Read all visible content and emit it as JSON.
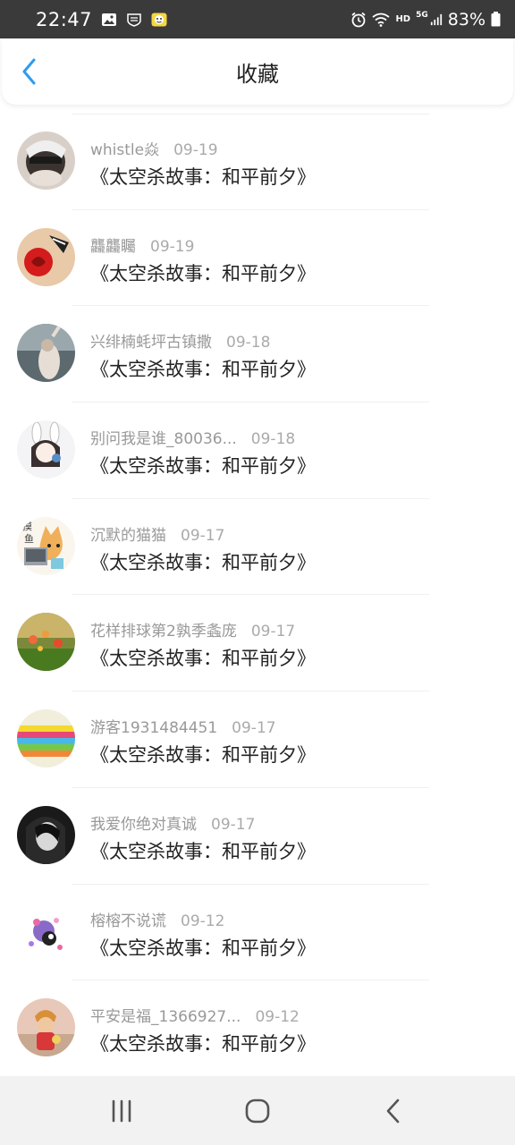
{
  "status_bar": {
    "time": "22:47",
    "icons_left": [
      "gallery-icon",
      "shield-icon",
      "app-face-icon"
    ],
    "icons_right": [
      "alarm-icon",
      "wifi-icon",
      "hd-icon",
      "5g-signal-icon",
      "battery-icon"
    ],
    "hd_label": "HD",
    "network_label": "5G",
    "battery": "83%"
  },
  "header": {
    "back_icon": "chevron-left-icon",
    "title": "收藏"
  },
  "colors": {
    "accent": "#2e9bf0",
    "status_bar": "#3a3a3a"
  },
  "favorites": [
    {
      "user": "whistle焱",
      "date": "09-19",
      "title": "《太空杀故事：和平前夕》"
    },
    {
      "user": "龘龘矚",
      "date": "09-19",
      "title": "《太空杀故事：和平前夕》"
    },
    {
      "user": "兴绯楠蚝坪古镇撒",
      "date": "09-18",
      "title": "《太空杀故事：和平前夕》"
    },
    {
      "user": "别问我是谁_80036...",
      "date": "09-18",
      "title": "《太空杀故事：和平前夕》"
    },
    {
      "user": "沉默的猫猫",
      "date": "09-17",
      "title": "《太空杀故事：和平前夕》"
    },
    {
      "user": "花样排球第2孰季螽庞",
      "date": "09-17",
      "title": "《太空杀故事：和平前夕》"
    },
    {
      "user": "游客1931484451",
      "date": "09-17",
      "title": "《太空杀故事：和平前夕》"
    },
    {
      "user": "我爱你绝对真诚",
      "date": "09-17",
      "title": "《太空杀故事：和平前夕》"
    },
    {
      "user": "榕榕不说谎",
      "date": "09-12",
      "title": "《太空杀故事：和平前夕》"
    },
    {
      "user": "平安是福_1366927...",
      "date": "09-12",
      "title": "《太空杀故事：和平前夕》"
    }
  ],
  "nav_bar": {
    "buttons": [
      "recent-apps-icon",
      "home-icon",
      "back-icon"
    ]
  }
}
